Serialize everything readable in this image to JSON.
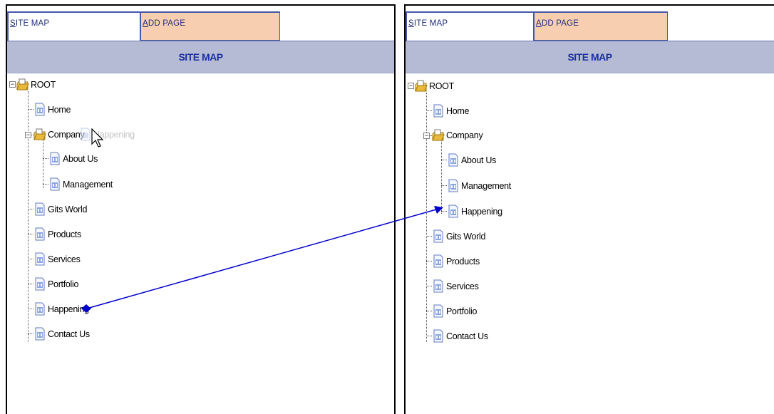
{
  "tabs": {
    "site_map_prefix": "S",
    "site_map_rest": "ITE MAP",
    "add_page_prefix": "A",
    "add_page_rest": "DD PAGE"
  },
  "header": {
    "title": "SITE MAP"
  },
  "left_tree": {
    "root": "ROOT",
    "items": [
      "Home",
      "Company",
      "About Us",
      "Management",
      "Gits World",
      "Products",
      "Services",
      "Portfolio",
      "Happening",
      "Contact Us"
    ],
    "drag_ghost": "Happening"
  },
  "right_tree": {
    "root": "ROOT",
    "items": [
      "Home",
      "Company",
      "About Us",
      "Management",
      "Happening",
      "Gits World",
      "Products",
      "Services",
      "Portfolio",
      "Contact Us"
    ]
  },
  "colors": {
    "tab_active": "#ffffff",
    "tab_inactive": "#f7cfb0",
    "header_bg": "#b5bbd5",
    "header_text": "#1c2fa0",
    "arrow": "#0000cc"
  },
  "icons": {
    "folder": "folder-open-icon",
    "page": "page-icon",
    "cursor": "mouse-pointer-icon"
  }
}
